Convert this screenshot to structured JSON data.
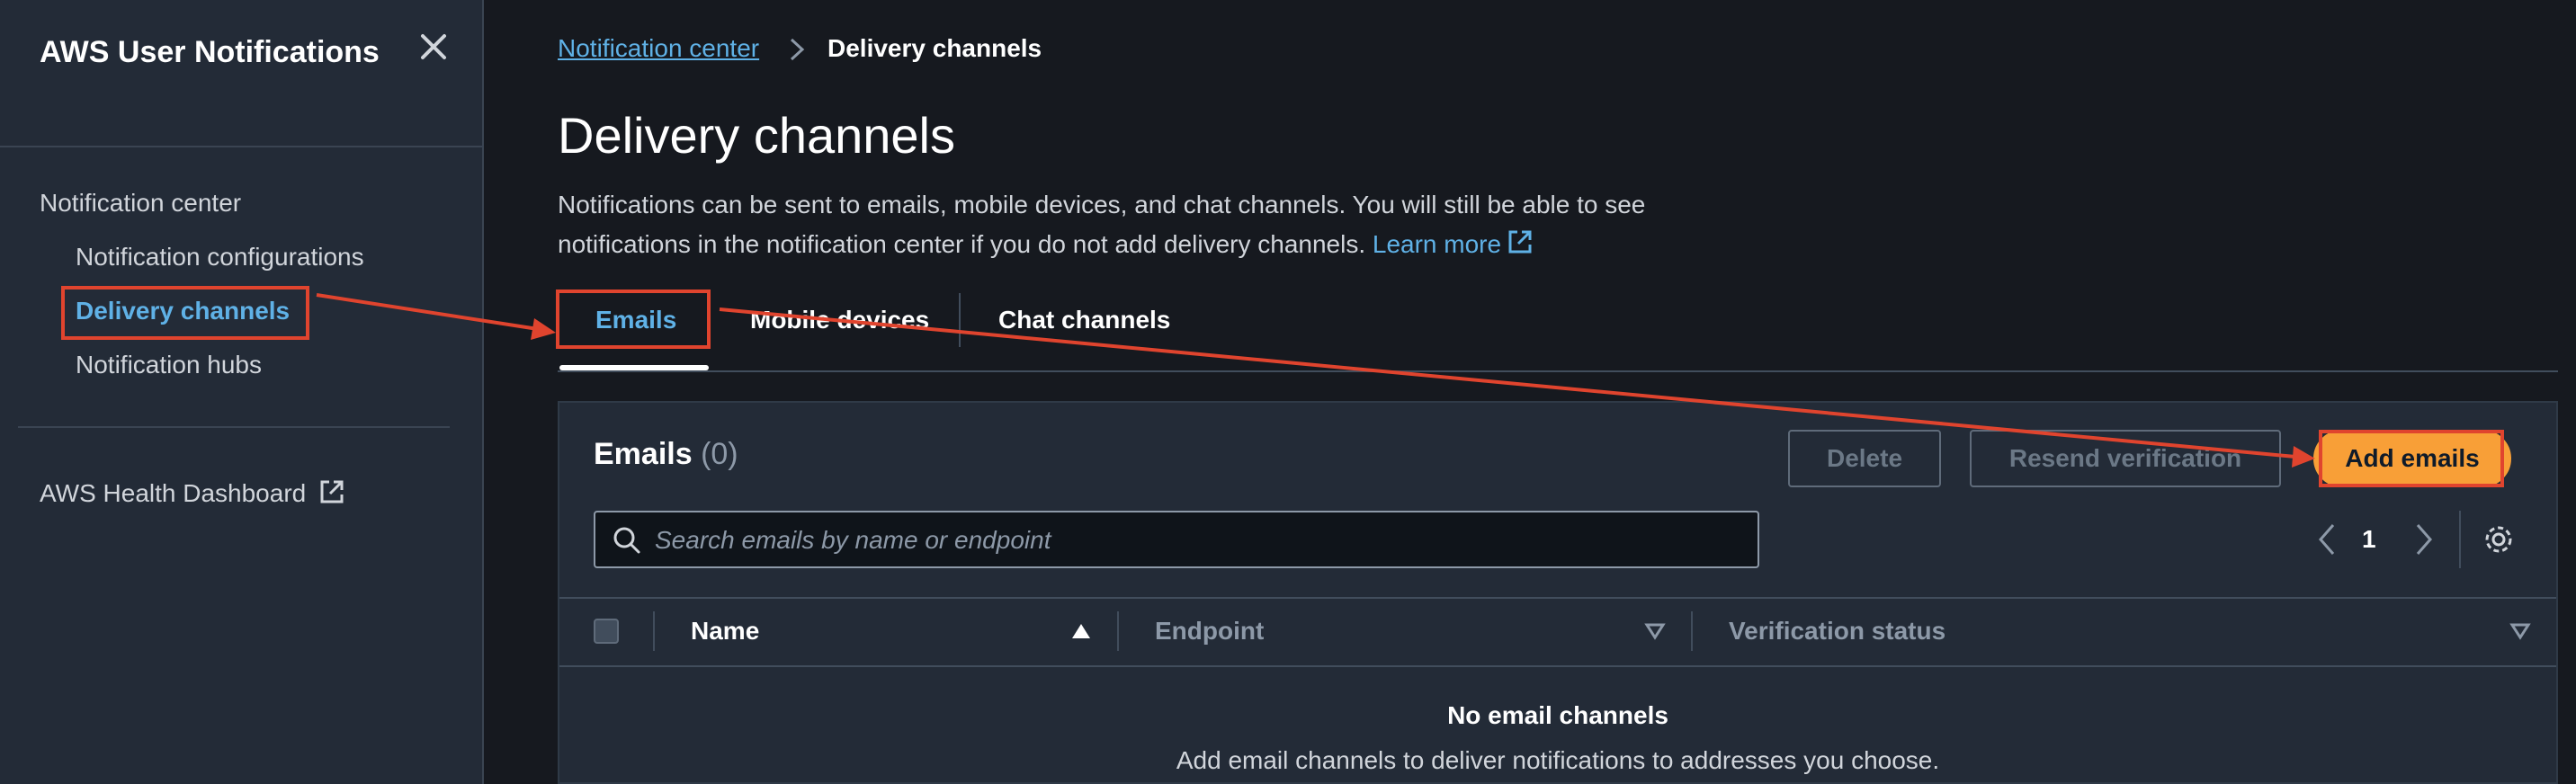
{
  "sidebar": {
    "title": "AWS User Notifications",
    "items": [
      {
        "label": "Notification center"
      },
      {
        "label": "Notification configurations"
      },
      {
        "label": "Delivery channels"
      },
      {
        "label": "Notification hubs"
      }
    ],
    "health_link": "AWS Health Dashboard"
  },
  "breadcrumb": {
    "root": "Notification center",
    "current": "Delivery channels"
  },
  "page": {
    "title": "Delivery channels",
    "description": "Notifications can be sent to emails, mobile devices, and chat channels. You will still be able to see notifications in the notification center if you do not add delivery channels.",
    "learn_more": "Learn more"
  },
  "tabs": [
    {
      "label": "Emails"
    },
    {
      "label": "Mobile devices"
    },
    {
      "label": "Chat channels"
    }
  ],
  "emails_panel": {
    "title": "Emails",
    "count": "(0)",
    "delete_label": "Delete",
    "resend_label": "Resend verification",
    "add_label": "Add emails",
    "search_placeholder": "Search emails by name or endpoint",
    "page_number": "1",
    "columns": [
      "Name",
      "Endpoint",
      "Verification status"
    ],
    "empty_title": "No email channels",
    "empty_desc": "Add email channels to deliver notifications to addresses you choose."
  },
  "colors": {
    "background": "#16191f",
    "sidebar": "#232b37",
    "accent_link": "#5fb1e6",
    "primary_button": "#f89f37",
    "annotation": "#e0442e"
  }
}
